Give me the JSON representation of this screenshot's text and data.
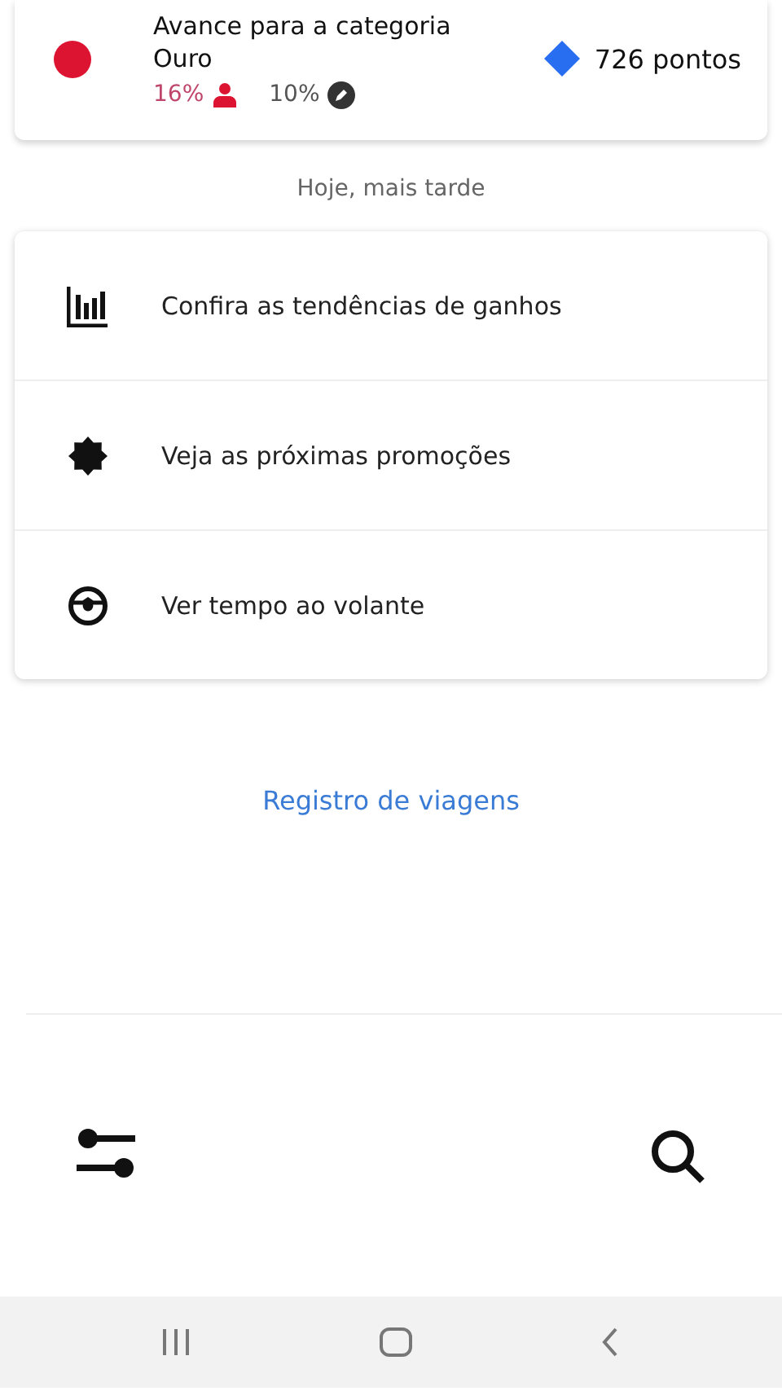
{
  "tier_card": {
    "title": "Avance para a categoria",
    "tier": "Ouro",
    "acceptance_rate": "16%",
    "cancellation_rate": "10%",
    "points": "726 pontos"
  },
  "section_label": "Hoje, mais tarde",
  "actions": [
    {
      "kind": "chart",
      "label": "Confira as tendências de ganhos"
    },
    {
      "kind": "promo",
      "label": "Veja as próximas promoções"
    },
    {
      "kind": "wheel",
      "label": "Ver tempo ao volante"
    }
  ],
  "trips_link": "Registro de viagens"
}
